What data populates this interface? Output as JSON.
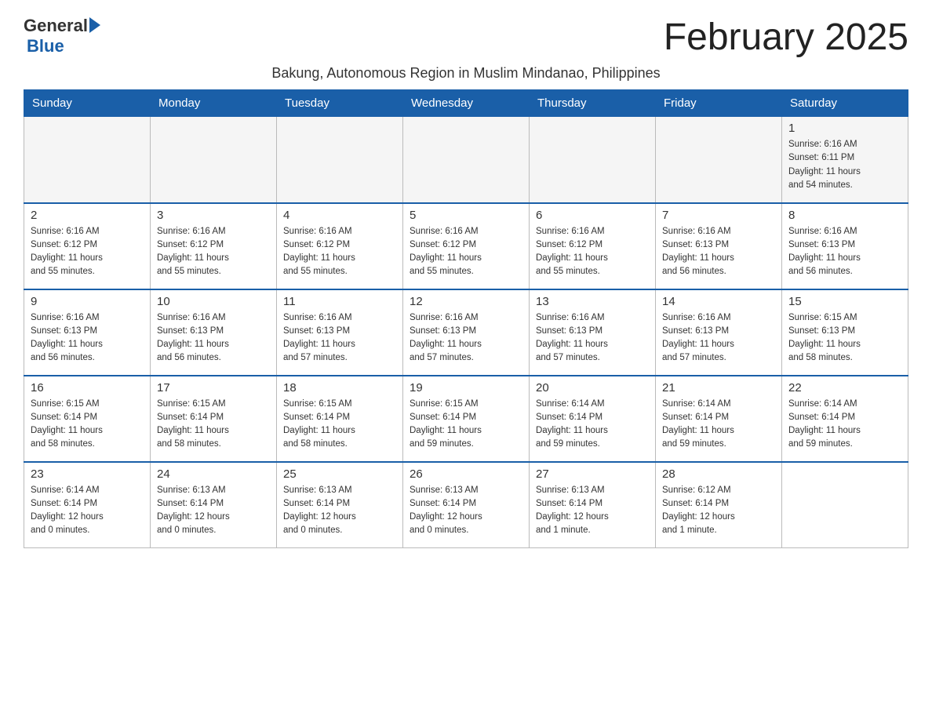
{
  "header": {
    "logo_general": "General",
    "logo_blue": "Blue",
    "title": "February 2025",
    "subtitle": "Bakung, Autonomous Region in Muslim Mindanao, Philippines"
  },
  "weekdays": [
    "Sunday",
    "Monday",
    "Tuesday",
    "Wednesday",
    "Thursday",
    "Friday",
    "Saturday"
  ],
  "weeks": [
    [
      {
        "day": "",
        "info": ""
      },
      {
        "day": "",
        "info": ""
      },
      {
        "day": "",
        "info": ""
      },
      {
        "day": "",
        "info": ""
      },
      {
        "day": "",
        "info": ""
      },
      {
        "day": "",
        "info": ""
      },
      {
        "day": "1",
        "info": "Sunrise: 6:16 AM\nSunset: 6:11 PM\nDaylight: 11 hours\nand 54 minutes."
      }
    ],
    [
      {
        "day": "2",
        "info": "Sunrise: 6:16 AM\nSunset: 6:12 PM\nDaylight: 11 hours\nand 55 minutes."
      },
      {
        "day": "3",
        "info": "Sunrise: 6:16 AM\nSunset: 6:12 PM\nDaylight: 11 hours\nand 55 minutes."
      },
      {
        "day": "4",
        "info": "Sunrise: 6:16 AM\nSunset: 6:12 PM\nDaylight: 11 hours\nand 55 minutes."
      },
      {
        "day": "5",
        "info": "Sunrise: 6:16 AM\nSunset: 6:12 PM\nDaylight: 11 hours\nand 55 minutes."
      },
      {
        "day": "6",
        "info": "Sunrise: 6:16 AM\nSunset: 6:12 PM\nDaylight: 11 hours\nand 55 minutes."
      },
      {
        "day": "7",
        "info": "Sunrise: 6:16 AM\nSunset: 6:13 PM\nDaylight: 11 hours\nand 56 minutes."
      },
      {
        "day": "8",
        "info": "Sunrise: 6:16 AM\nSunset: 6:13 PM\nDaylight: 11 hours\nand 56 minutes."
      }
    ],
    [
      {
        "day": "9",
        "info": "Sunrise: 6:16 AM\nSunset: 6:13 PM\nDaylight: 11 hours\nand 56 minutes."
      },
      {
        "day": "10",
        "info": "Sunrise: 6:16 AM\nSunset: 6:13 PM\nDaylight: 11 hours\nand 56 minutes."
      },
      {
        "day": "11",
        "info": "Sunrise: 6:16 AM\nSunset: 6:13 PM\nDaylight: 11 hours\nand 57 minutes."
      },
      {
        "day": "12",
        "info": "Sunrise: 6:16 AM\nSunset: 6:13 PM\nDaylight: 11 hours\nand 57 minutes."
      },
      {
        "day": "13",
        "info": "Sunrise: 6:16 AM\nSunset: 6:13 PM\nDaylight: 11 hours\nand 57 minutes."
      },
      {
        "day": "14",
        "info": "Sunrise: 6:16 AM\nSunset: 6:13 PM\nDaylight: 11 hours\nand 57 minutes."
      },
      {
        "day": "15",
        "info": "Sunrise: 6:15 AM\nSunset: 6:13 PM\nDaylight: 11 hours\nand 58 minutes."
      }
    ],
    [
      {
        "day": "16",
        "info": "Sunrise: 6:15 AM\nSunset: 6:14 PM\nDaylight: 11 hours\nand 58 minutes."
      },
      {
        "day": "17",
        "info": "Sunrise: 6:15 AM\nSunset: 6:14 PM\nDaylight: 11 hours\nand 58 minutes."
      },
      {
        "day": "18",
        "info": "Sunrise: 6:15 AM\nSunset: 6:14 PM\nDaylight: 11 hours\nand 58 minutes."
      },
      {
        "day": "19",
        "info": "Sunrise: 6:15 AM\nSunset: 6:14 PM\nDaylight: 11 hours\nand 59 minutes."
      },
      {
        "day": "20",
        "info": "Sunrise: 6:14 AM\nSunset: 6:14 PM\nDaylight: 11 hours\nand 59 minutes."
      },
      {
        "day": "21",
        "info": "Sunrise: 6:14 AM\nSunset: 6:14 PM\nDaylight: 11 hours\nand 59 minutes."
      },
      {
        "day": "22",
        "info": "Sunrise: 6:14 AM\nSunset: 6:14 PM\nDaylight: 11 hours\nand 59 minutes."
      }
    ],
    [
      {
        "day": "23",
        "info": "Sunrise: 6:14 AM\nSunset: 6:14 PM\nDaylight: 12 hours\nand 0 minutes."
      },
      {
        "day": "24",
        "info": "Sunrise: 6:13 AM\nSunset: 6:14 PM\nDaylight: 12 hours\nand 0 minutes."
      },
      {
        "day": "25",
        "info": "Sunrise: 6:13 AM\nSunset: 6:14 PM\nDaylight: 12 hours\nand 0 minutes."
      },
      {
        "day": "26",
        "info": "Sunrise: 6:13 AM\nSunset: 6:14 PM\nDaylight: 12 hours\nand 0 minutes."
      },
      {
        "day": "27",
        "info": "Sunrise: 6:13 AM\nSunset: 6:14 PM\nDaylight: 12 hours\nand 1 minute."
      },
      {
        "day": "28",
        "info": "Sunrise: 6:12 AM\nSunset: 6:14 PM\nDaylight: 12 hours\nand 1 minute."
      },
      {
        "day": "",
        "info": ""
      }
    ]
  ]
}
